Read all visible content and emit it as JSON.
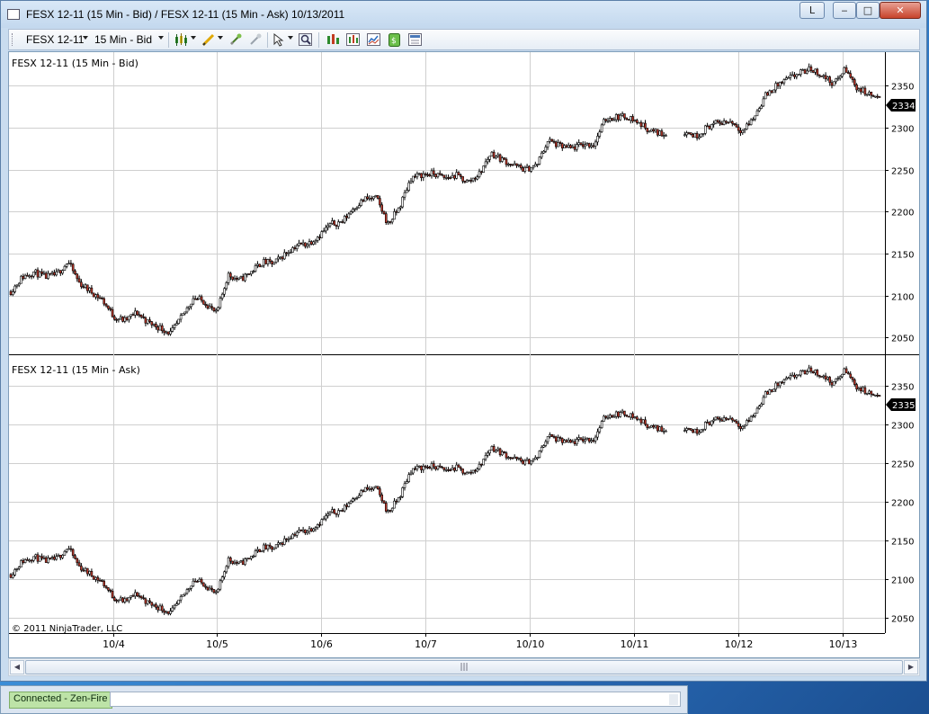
{
  "window": {
    "title": "FESX 12-11 (15 Min - Bid) / FESX 12-11 (15 Min - Ask)  10/13/2011",
    "caption_l": "L",
    "caption_min": "‒",
    "caption_max": "□",
    "caption_close": "✕"
  },
  "toolbar": {
    "instrument": "FESX 12-11",
    "interval": "15 Min - Bid",
    "icons": [
      "candlestick-style-icon",
      "pencil-drawing-icon",
      "crosshair-icon",
      "global-crosshair-icon",
      "pointer-icon",
      "zoom-icon",
      "bar-spacing-icon",
      "data-box-icon",
      "indicators-icon",
      "strategy-icon",
      "properties-icon"
    ]
  },
  "panels": {
    "top": {
      "label": "FESX 12-11 (15 Min - Bid)",
      "last_price": "2334"
    },
    "bottom": {
      "label": "FESX 12-11 (15 Min - Ask)",
      "last_price": "2335"
    }
  },
  "y_ticks": [
    "2350",
    "2300",
    "2250",
    "2200",
    "2150",
    "2100",
    "2050"
  ],
  "x_ticks": [
    "10/4",
    "10/5",
    "10/6",
    "10/7",
    "10/10",
    "10/11",
    "10/12",
    "10/13"
  ],
  "copyright": "© 2011 NinjaTrader, LLC",
  "scrollbar": {
    "thumb_glyph": "|||"
  },
  "status": {
    "connection": "Connected - Zen-Fire"
  },
  "colors": {
    "up_body": "#ffffff",
    "down_body": "#c0392b",
    "wick": "#000000",
    "grid": "#cfcfcf",
    "price_marker": "#000000"
  },
  "chart_data": {
    "type": "candlestick",
    "bar_interval": "15 Min",
    "ylim": [
      2030,
      2390
    ],
    "series": [
      {
        "name": "FESX 12-11 (15 Min - Bid)",
        "close_path": [
          [
            "10/3",
            2105
          ],
          [
            "10/3",
            2122
          ],
          [
            "10/3",
            2128
          ],
          [
            "10/3",
            2122
          ],
          [
            "10/3",
            2125
          ],
          [
            "10/3",
            2140
          ],
          [
            "10/3",
            2115
          ],
          [
            "10/4",
            2105
          ],
          [
            "10/4",
            2095
          ],
          [
            "10/4",
            2075
          ],
          [
            "10/4",
            2070
          ],
          [
            "10/4",
            2080
          ],
          [
            "10/4",
            2068
          ],
          [
            "10/4",
            2062
          ],
          [
            "10/4",
            2055
          ],
          [
            "10/4",
            2075
          ],
          [
            "10/4",
            2098
          ],
          [
            "10/4",
            2092
          ],
          [
            "10/4",
            2078
          ],
          [
            "10/5",
            2125
          ],
          [
            "10/5",
            2118
          ],
          [
            "10/5",
            2128
          ],
          [
            "10/5",
            2140
          ],
          [
            "10/5",
            2138
          ],
          [
            "10/5",
            2150
          ],
          [
            "10/5",
            2160
          ],
          [
            "10/5",
            2162
          ],
          [
            "10/6",
            2172
          ],
          [
            "10/6",
            2185
          ],
          [
            "10/6",
            2188
          ],
          [
            "10/6",
            2205
          ],
          [
            "10/6",
            2215
          ],
          [
            "10/6",
            2216
          ],
          [
            "10/6",
            2185
          ],
          [
            "10/6",
            2205
          ],
          [
            "10/6",
            2240
          ],
          [
            "10/7",
            2244
          ],
          [
            "10/7",
            2245
          ],
          [
            "10/7",
            2240
          ],
          [
            "10/7",
            2243
          ],
          [
            "10/7",
            2235
          ],
          [
            "10/7",
            2245
          ],
          [
            "10/7",
            2270
          ],
          [
            "10/7",
            2262
          ],
          [
            "10/7",
            2255
          ],
          [
            "10/7",
            2250
          ],
          [
            "10/7",
            2255
          ],
          [
            "10/10",
            2285
          ],
          [
            "10/10",
            2278
          ],
          [
            "10/10",
            2275
          ],
          [
            "10/10",
            2280
          ],
          [
            "10/10",
            2280
          ],
          [
            "10/10",
            2310
          ],
          [
            "10/10",
            2313
          ],
          [
            "10/10",
            2313
          ],
          [
            "10/11",
            2305
          ],
          [
            "10/11",
            2296
          ],
          [
            "10/11",
            2293
          ],
          [
            "10/11",
            2292
          ],
          [
            "10/11",
            2295
          ],
          [
            "10/11",
            2290
          ],
          [
            "10/11",
            2302
          ],
          [
            "10/11",
            2306
          ],
          [
            "10/12",
            2308
          ],
          [
            "10/12",
            2296
          ],
          [
            "10/12",
            2312
          ],
          [
            "10/12",
            2338
          ],
          [
            "10/12",
            2350
          ],
          [
            "10/12",
            2358
          ],
          [
            "10/12",
            2365
          ],
          [
            "10/12",
            2370
          ],
          [
            "10/13",
            2362
          ],
          [
            "10/13",
            2352
          ],
          [
            "10/13",
            2370
          ],
          [
            "10/13",
            2348
          ],
          [
            "10/13",
            2340
          ],
          [
            "10/13",
            2334
          ]
        ],
        "last": 2334
      },
      {
        "name": "FESX 12-11 (15 Min - Ask)",
        "close_path": [
          [
            "10/3",
            2106
          ],
          [
            "10/3",
            2123
          ],
          [
            "10/3",
            2129
          ],
          [
            "10/3",
            2123
          ],
          [
            "10/3",
            2126
          ],
          [
            "10/3",
            2141
          ],
          [
            "10/3",
            2116
          ],
          [
            "10/4",
            2106
          ],
          [
            "10/4",
            2096
          ],
          [
            "10/4",
            2076
          ],
          [
            "10/4",
            2071
          ],
          [
            "10/4",
            2081
          ],
          [
            "10/4",
            2069
          ],
          [
            "10/4",
            2063
          ],
          [
            "10/4",
            2056
          ],
          [
            "10/4",
            2076
          ],
          [
            "10/4",
            2099
          ],
          [
            "10/4",
            2093
          ],
          [
            "10/4",
            2079
          ],
          [
            "10/5",
            2126
          ],
          [
            "10/5",
            2119
          ],
          [
            "10/5",
            2129
          ],
          [
            "10/5",
            2141
          ],
          [
            "10/5",
            2139
          ],
          [
            "10/5",
            2151
          ],
          [
            "10/5",
            2161
          ],
          [
            "10/5",
            2163
          ],
          [
            "10/6",
            2173
          ],
          [
            "10/6",
            2186
          ],
          [
            "10/6",
            2189
          ],
          [
            "10/6",
            2206
          ],
          [
            "10/6",
            2216
          ],
          [
            "10/6",
            2217
          ],
          [
            "10/6",
            2186
          ],
          [
            "10/6",
            2206
          ],
          [
            "10/6",
            2241
          ],
          [
            "10/7",
            2245
          ],
          [
            "10/7",
            2246
          ],
          [
            "10/7",
            2241
          ],
          [
            "10/7",
            2244
          ],
          [
            "10/7",
            2236
          ],
          [
            "10/7",
            2246
          ],
          [
            "10/7",
            2271
          ],
          [
            "10/7",
            2263
          ],
          [
            "10/7",
            2256
          ],
          [
            "10/7",
            2251
          ],
          [
            "10/7",
            2256
          ],
          [
            "10/10",
            2286
          ],
          [
            "10/10",
            2279
          ],
          [
            "10/10",
            2276
          ],
          [
            "10/10",
            2281
          ],
          [
            "10/10",
            2281
          ],
          [
            "10/10",
            2311
          ],
          [
            "10/10",
            2314
          ],
          [
            "10/10",
            2314
          ],
          [
            "10/11",
            2306
          ],
          [
            "10/11",
            2297
          ],
          [
            "10/11",
            2294
          ],
          [
            "10/11",
            2293
          ],
          [
            "10/11",
            2296
          ],
          [
            "10/11",
            2291
          ],
          [
            "10/11",
            2303
          ],
          [
            "10/11",
            2307
          ],
          [
            "10/12",
            2309
          ],
          [
            "10/12",
            2297
          ],
          [
            "10/12",
            2313
          ],
          [
            "10/12",
            2339
          ],
          [
            "10/12",
            2351
          ],
          [
            "10/12",
            2359
          ],
          [
            "10/12",
            2366
          ],
          [
            "10/12",
            2371
          ],
          [
            "10/13",
            2363
          ],
          [
            "10/13",
            2353
          ],
          [
            "10/13",
            2371
          ],
          [
            "10/13",
            2349
          ],
          [
            "10/13",
            2341
          ],
          [
            "10/13",
            2335
          ]
        ],
        "last": 2335
      }
    ]
  }
}
